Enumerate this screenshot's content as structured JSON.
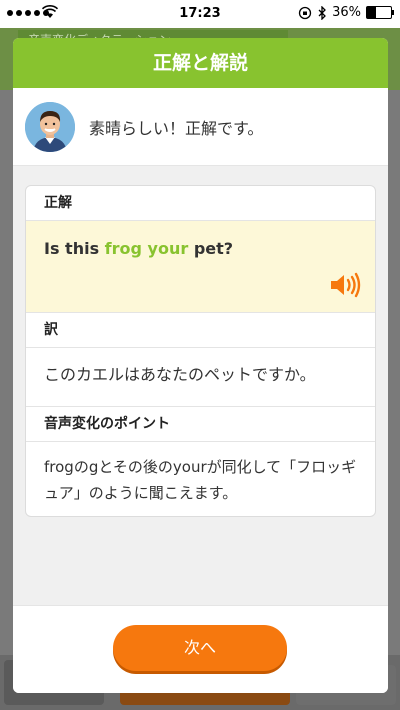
{
  "status_bar": {
    "time": "17:23",
    "battery_percent": "36%",
    "battery_level": 0.36
  },
  "background": {
    "tag_label": "音声変化ディクテーション"
  },
  "modal": {
    "title": "正解と解説",
    "feedback_message": "素晴らしい！正解です。",
    "answer_section": {
      "heading": "正解",
      "sentence_before": "Is this ",
      "sentence_highlight": "frog your",
      "sentence_after": " pet?",
      "speaker_icon": "speaker-icon"
    },
    "translation_section": {
      "heading": "訳",
      "text": "このカエルはあなたのペットですか。"
    },
    "point_section": {
      "heading": "音声変化のポイント",
      "text": "frogのgとその後のyourが同化して「フロッギュア」のように聞こえます。"
    },
    "next_button_label": "次へ"
  },
  "colors": {
    "header_green": "#88c32f",
    "highlight_green": "#88c32f",
    "answer_bg": "#fdf8d8",
    "button_orange": "#f6780e",
    "speaker_orange": "#f6780e"
  }
}
